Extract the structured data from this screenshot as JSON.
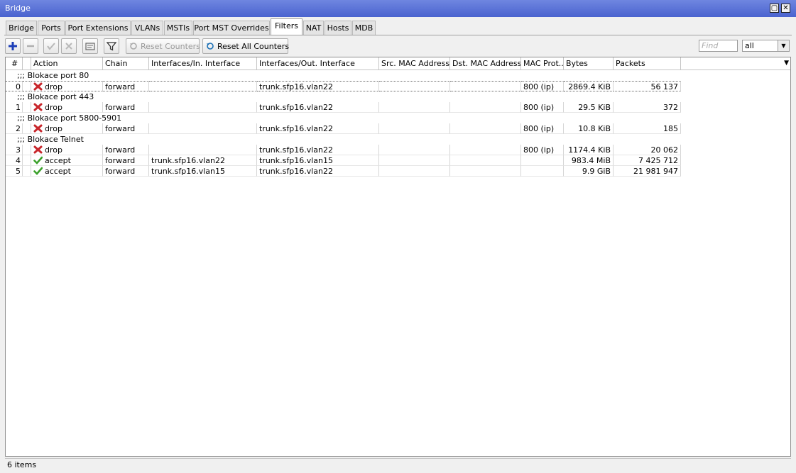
{
  "window": {
    "title": "Bridge"
  },
  "tabs": [
    "Bridge",
    "Ports",
    "Port Extensions",
    "VLANs",
    "MSTIs",
    "Port MST Overrides",
    "Filters",
    "NAT",
    "Hosts",
    "MDB"
  ],
  "active_tab": "Filters",
  "toolbar": {
    "reset_counters": "Reset Counters",
    "reset_all_counters": "Reset All Counters",
    "find_placeholder": "Find",
    "filter_value": "all"
  },
  "columns": [
    "#",
    "Action",
    "Chain",
    "Interfaces/In. Interface",
    "Interfaces/Out. Interface",
    "Src. MAC Address...",
    "Dst. MAC Address...",
    "MAC Prot...",
    "Bytes",
    "Packets"
  ],
  "rows": [
    {
      "type": "comment",
      "text": ";;; Blokace port 80"
    },
    {
      "type": "rule",
      "num": "0",
      "action": "drop",
      "chain": "forward",
      "in": "",
      "out": "trunk.sfp16.vlan22",
      "src": "",
      "dst": "",
      "proto": "800 (ip)",
      "bytes": "2869.4 KiB",
      "packets": "56 137",
      "selected": true
    },
    {
      "type": "comment",
      "text": ";;; Blokace port 443"
    },
    {
      "type": "rule",
      "num": "1",
      "action": "drop",
      "chain": "forward",
      "in": "",
      "out": "trunk.sfp16.vlan22",
      "src": "",
      "dst": "",
      "proto": "800 (ip)",
      "bytes": "29.5 KiB",
      "packets": "372"
    },
    {
      "type": "comment",
      "text": ";;; Blokace port 5800-5901"
    },
    {
      "type": "rule",
      "num": "2",
      "action": "drop",
      "chain": "forward",
      "in": "",
      "out": "trunk.sfp16.vlan22",
      "src": "",
      "dst": "",
      "proto": "800 (ip)",
      "bytes": "10.8 KiB",
      "packets": "185"
    },
    {
      "type": "comment",
      "text": ";;; Blokace Telnet"
    },
    {
      "type": "rule",
      "num": "3",
      "action": "drop",
      "chain": "forward",
      "in": "",
      "out": "trunk.sfp16.vlan22",
      "src": "",
      "dst": "",
      "proto": "800 (ip)",
      "bytes": "1174.4 KiB",
      "packets": "20 062"
    },
    {
      "type": "rule",
      "num": "4",
      "action": "accept",
      "chain": "forward",
      "in": "trunk.sfp16.vlan22",
      "out": "trunk.sfp16.vlan15",
      "src": "",
      "dst": "",
      "proto": "",
      "bytes": "983.4 MiB",
      "packets": "7 425 712"
    },
    {
      "type": "rule",
      "num": "5",
      "action": "accept",
      "chain": "forward",
      "in": "trunk.sfp16.vlan15",
      "out": "trunk.sfp16.vlan22",
      "src": "",
      "dst": "",
      "proto": "",
      "bytes": "9.9 GiB",
      "packets": "21 981 947"
    }
  ],
  "status": {
    "count": "6 items"
  },
  "colors": {
    "titlebar": "#4a63cf",
    "drop_icon": "#c8262b",
    "accept_icon": "#3aa02a"
  }
}
